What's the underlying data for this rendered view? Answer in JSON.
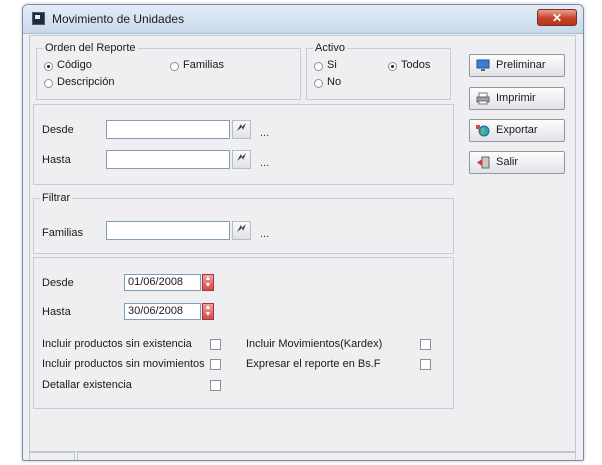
{
  "window": {
    "title": "Movimiento de Unidades",
    "close_label": "✕"
  },
  "orden": {
    "legend": "Orden del Reporte",
    "options": [
      "Código",
      "Familias",
      "Descripción"
    ],
    "selected": "Código"
  },
  "activo": {
    "legend": "Activo",
    "options": [
      "Si",
      "Todos",
      "No"
    ],
    "selected": "Todos"
  },
  "rango": {
    "desde_label": "Desde",
    "hasta_label": "Hasta",
    "desde_value": "",
    "hasta_value": "",
    "ellipsis": "..."
  },
  "filtrar": {
    "legend": "Filtrar",
    "familias_label": "Familias",
    "familias_value": "",
    "ellipsis": "..."
  },
  "fechas": {
    "desde_label": "Desde",
    "hasta_label": "Hasta",
    "desde_value": "01/06/2008",
    "hasta_value": "30/06/2008"
  },
  "options": {
    "incluir_sin_existencia": "Incluir productos sin existencia",
    "incluir_sin_movimientos": "Incluir productos sin movimientos",
    "detallar_existencia": "Detallar existencia",
    "incluir_movimientos_kardex": "Incluir Movimientos(Kardex)",
    "expresar_bsf": "Expresar el reporte en Bs.F"
  },
  "buttons": {
    "preliminar": "Preliminar",
    "imprimir": "Imprimir",
    "exportar": "Exportar",
    "salir": "Salir"
  },
  "colors": {
    "accent": "#7f9db9",
    "close": "#c7422a"
  }
}
